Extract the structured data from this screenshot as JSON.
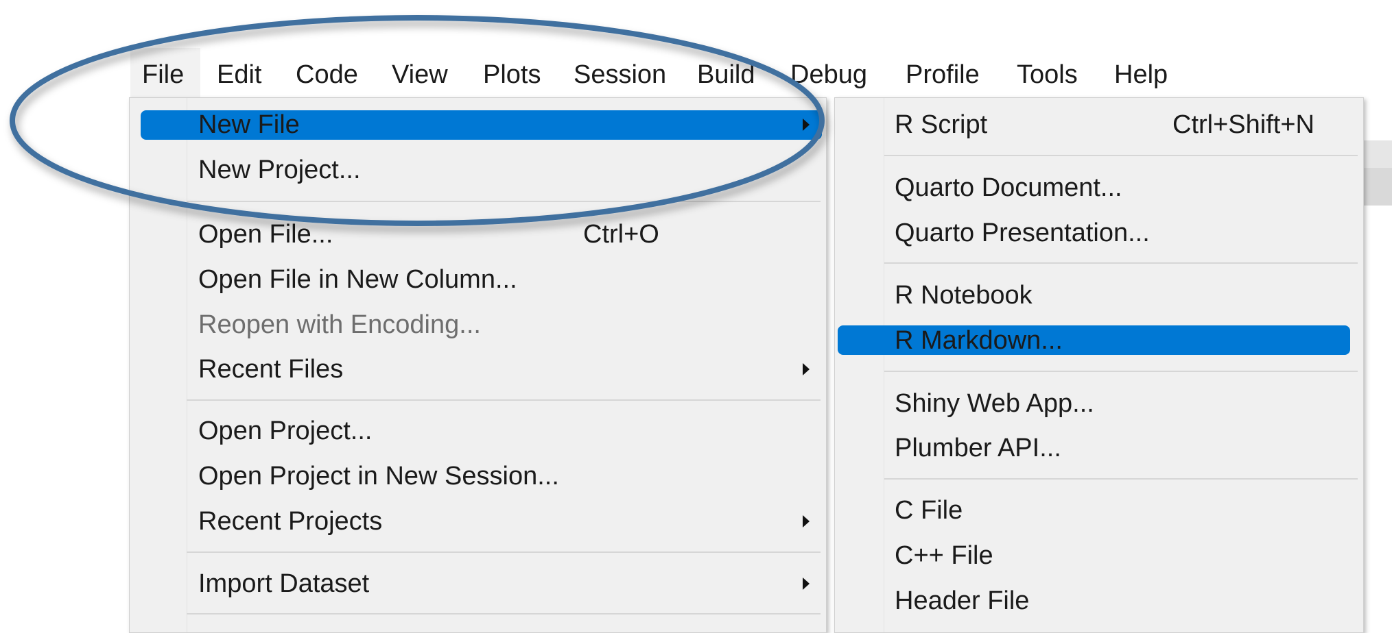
{
  "menubar": {
    "items": [
      "File",
      "Edit",
      "Code",
      "View",
      "Plots",
      "Session",
      "Build",
      "Debug",
      "Profile",
      "Tools",
      "Help"
    ],
    "active": "File"
  },
  "file_menu": {
    "items": [
      {
        "label": "New File",
        "submenu": true,
        "highlighted": true
      },
      {
        "label": "New Project..."
      },
      {
        "label": "Open File...",
        "shortcut": "Ctrl+O"
      },
      {
        "label": "Open File in New Column..."
      },
      {
        "label": "Reopen with Encoding...",
        "disabled": true
      },
      {
        "label": "Recent Files",
        "submenu": true
      },
      {
        "label": "Open Project..."
      },
      {
        "label": "Open Project in New Session..."
      },
      {
        "label": "Recent Projects",
        "submenu": true
      },
      {
        "label": "Import Dataset",
        "submenu": true
      }
    ]
  },
  "new_file_submenu": {
    "items": [
      {
        "label": "R Script",
        "shortcut": "Ctrl+Shift+N"
      },
      {
        "label": "Quarto Document..."
      },
      {
        "label": "Quarto Presentation..."
      },
      {
        "label": "R Notebook"
      },
      {
        "label": "R Markdown...",
        "highlighted": true
      },
      {
        "label": "Shiny Web App..."
      },
      {
        "label": "Plumber API..."
      },
      {
        "label": "C File"
      },
      {
        "label": "C++ File"
      },
      {
        "label": "Header File"
      }
    ]
  },
  "colors": {
    "highlight": "#0078d4",
    "annotation_ellipse": "#41709f",
    "menu_bg": "#f0f0f0"
  }
}
